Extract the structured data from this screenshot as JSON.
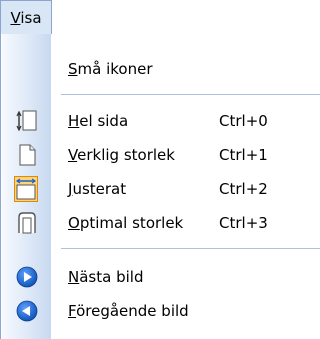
{
  "menu": {
    "title_accel": "V",
    "title_rest": "isa"
  },
  "items": [
    {
      "accel": "S",
      "rest": "må ikoner",
      "shortcut": "",
      "icon": "none"
    },
    {
      "accel": "H",
      "rest": "el sida",
      "shortcut": "Ctrl+0",
      "icon": "fit-page-icon"
    },
    {
      "accel": "V",
      "rest": "erklig storlek",
      "shortcut": "Ctrl+1",
      "icon": "actual-size-icon"
    },
    {
      "accel": "J",
      "rest": "usterat",
      "shortcut": "Ctrl+2",
      "icon": "fit-width-icon"
    },
    {
      "accel": "O",
      "rest": "ptimal storlek",
      "shortcut": "Ctrl+3",
      "icon": "best-fit-icon"
    },
    {
      "accel": "N",
      "rest": "ästa bild",
      "shortcut": "",
      "icon": "next-image-icon"
    },
    {
      "accel": "F",
      "rest": "öregående bild",
      "shortcut": "",
      "icon": "previous-image-icon"
    }
  ],
  "colors": {
    "accent_blue": "#1c62c9",
    "border": "#8aa6cc",
    "checked_bg": "#ffd37a",
    "checked_border": "#e08a00"
  }
}
